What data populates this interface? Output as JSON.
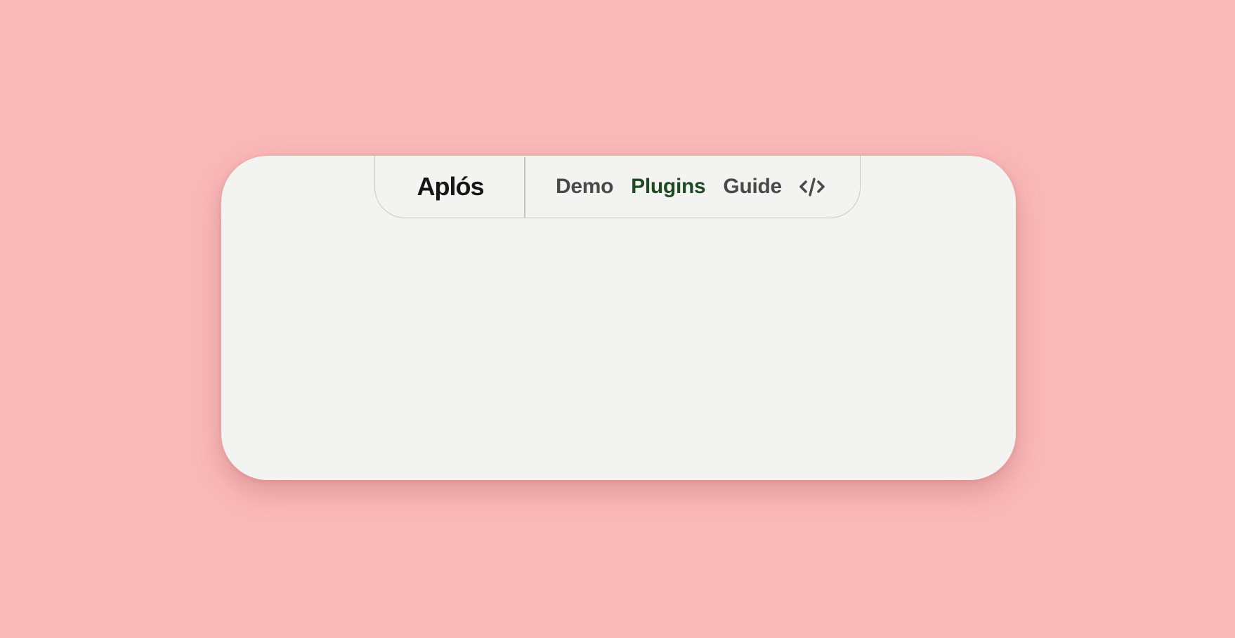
{
  "brand": {
    "name": "Aplós"
  },
  "nav": {
    "items": [
      {
        "label": "Demo",
        "active": false
      },
      {
        "label": "Plugins",
        "active": true
      },
      {
        "label": "Guide",
        "active": false
      }
    ],
    "code_icon": "code-brackets-icon"
  },
  "colors": {
    "background": "#fab9b9",
    "card": "#f3f4f1",
    "active_link": "#1f4a24",
    "link": "#4a4a4a",
    "brand": "#161616"
  }
}
